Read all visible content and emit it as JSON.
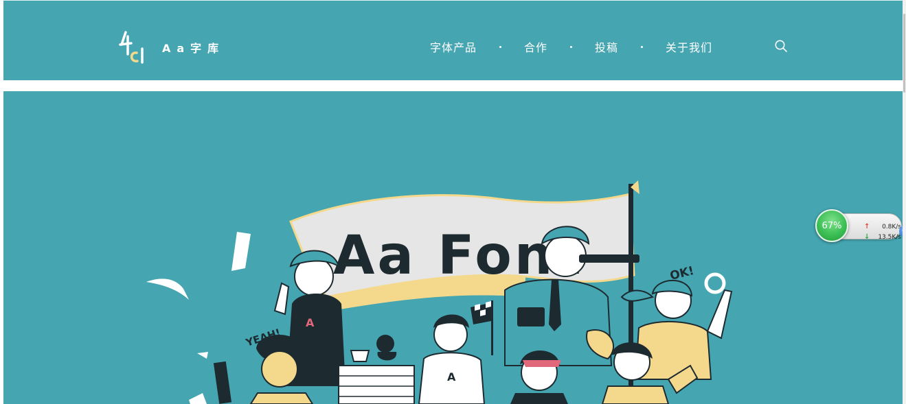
{
  "brand": {
    "name": "Aa字库"
  },
  "nav": {
    "items": [
      "字体产品",
      "合作",
      "投稿",
      "关于我们"
    ]
  },
  "hero": {
    "banner_text": "Aa Font",
    "speech_left": "YEAH!",
    "speech_right": "OK!",
    "shirt_letter": "A"
  },
  "network_widget": {
    "percent": "67%",
    "upload": "0.8K/s",
    "download": "13.5K/s"
  },
  "colors": {
    "teal": "#45a5b1",
    "cream": "#f4d98c",
    "dark": "#1d2a30",
    "white": "#ffffff",
    "flag": "#e7e6e6"
  },
  "icons": {
    "search": "search-icon",
    "plus": "plus-icon",
    "up": "upload-arrow-icon",
    "down": "download-arrow-icon"
  }
}
